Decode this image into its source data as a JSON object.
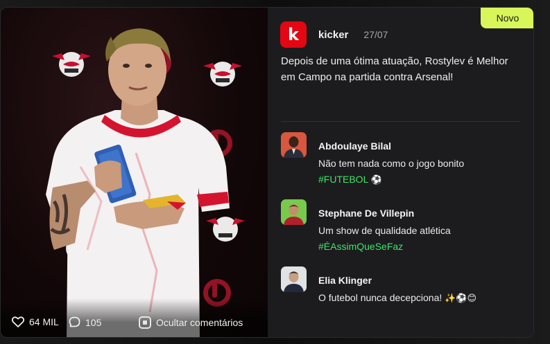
{
  "post": {
    "badge": "Novo",
    "source": "kicker",
    "source_logo_letter": "k",
    "date": "27/07",
    "text": "Depois de uma ótima atuação, Rostylev é Melhor em Campo na partida contra Arsenal!"
  },
  "stats": {
    "likes": "64 MIL",
    "comments": "105",
    "hide_comments_label": "Ocultar comentários"
  },
  "comments": [
    {
      "author": "Abdoulaye Bilal",
      "text": "Não tem nada como o jogo bonito",
      "tag": "#FUTEBOL",
      "emoji": "⚽",
      "avatar_color": "#d9573f"
    },
    {
      "author": "Stephane De Villepin",
      "text": "Um show de qualidade atlética",
      "tag": "#ÉAssimQueSeFaz",
      "emoji": "",
      "avatar_color": "#79c94c"
    },
    {
      "author": "Elia Klinger",
      "text": "O futebol nunca decepciona!",
      "tag": "",
      "emoji": "✨⚽😊",
      "avatar_color": "#dfe3e6"
    }
  ],
  "colors": {
    "accent_new": "#d8f55a",
    "hashtag": "#3ee46a",
    "kicker_red": "#e30613"
  },
  "icons": {
    "likes": "heart-icon",
    "comments": "speech-bubble-icon",
    "hide": "hide-comments-icon"
  }
}
